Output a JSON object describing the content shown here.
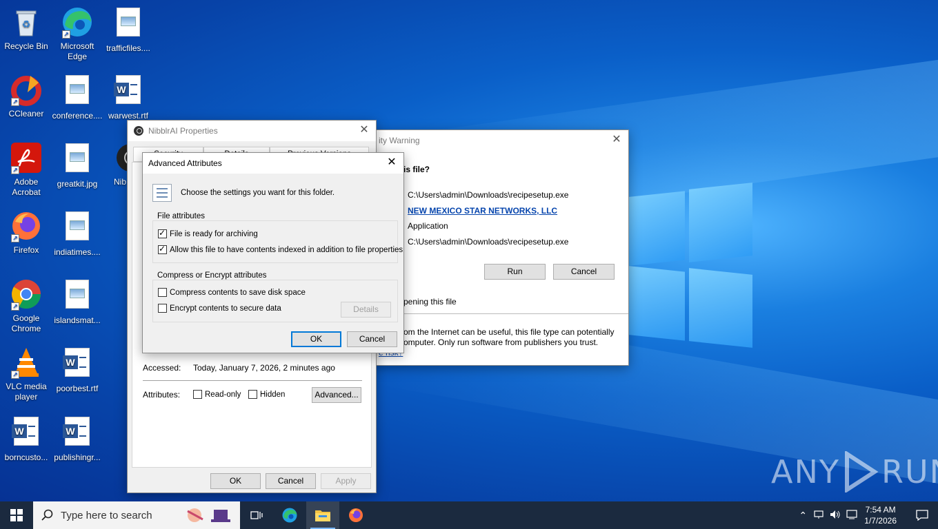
{
  "desktop": {
    "icons": [
      {
        "label": "Recycle Bin"
      },
      {
        "label": "Microsoft Edge"
      },
      {
        "label": "trafficfiles...."
      },
      {
        "label": "CCleaner"
      },
      {
        "label": "conference...."
      },
      {
        "label": "warwest.rtf"
      },
      {
        "label": "Adobe Acrobat"
      },
      {
        "label": "greatkit.jpg"
      },
      {
        "label": "Nib"
      },
      {
        "label": "Firefox"
      },
      {
        "label": "indiatimes...."
      },
      {
        "label": "Google Chrome"
      },
      {
        "label": "islandsmat..."
      },
      {
        "label": "VLC media player"
      },
      {
        "label": "poorbest.rtf"
      },
      {
        "label": "borncusto..."
      },
      {
        "label": "publishingr..."
      }
    ],
    "watermark": {
      "left": "ANY",
      "right": "RUN"
    }
  },
  "security_warning": {
    "title": "ity Warning",
    "question": "is file?",
    "name_value": "C:\\Users\\admin\\Downloads\\recipesetup.exe",
    "publisher_value": "NEW MEXICO STAR NETWORKS, LLC",
    "type_value": "Application",
    "from_value": "C:\\Users\\admin\\Downloads\\recipesetup.exe",
    "run_label": "Run",
    "cancel_label": "Cancel",
    "checkbox_text": "pening this file",
    "warning_line1": "om the Internet can be useful, this file type can potentially",
    "warning_line2": "omputer. Only run software from publishers you trust.",
    "risk_link": "e risk?"
  },
  "properties": {
    "title": "NibblrAI Properties",
    "tabs": [
      "Security",
      "Details",
      "Previous Versions"
    ],
    "accessed_label": "Accessed:",
    "accessed_value": "Today, January 7, 2026, 2 minutes ago",
    "attributes_label": "Attributes:",
    "readonly_label": "Read-only",
    "hidden_label": "Hidden",
    "advanced_label": "Advanced...",
    "ok_label": "OK",
    "cancel_label": "Cancel",
    "apply_label": "Apply"
  },
  "advanced": {
    "title": "Advanced Attributes",
    "intro": "Choose the settings you want for this folder.",
    "file_attributes_label": "File attributes",
    "archive_label": "File is ready for archiving",
    "index_label": "Allow this file to have contents indexed in addition to file properties",
    "compress_group_label": "Compress or Encrypt attributes",
    "compress_label": "Compress contents to save disk space",
    "encrypt_label": "Encrypt contents to secure data",
    "details_label": "Details",
    "ok_label": "OK",
    "cancel_label": "Cancel"
  },
  "taskbar": {
    "search_placeholder": "Type here to search",
    "time": "7:54 AM",
    "date": "1/7/2026"
  }
}
